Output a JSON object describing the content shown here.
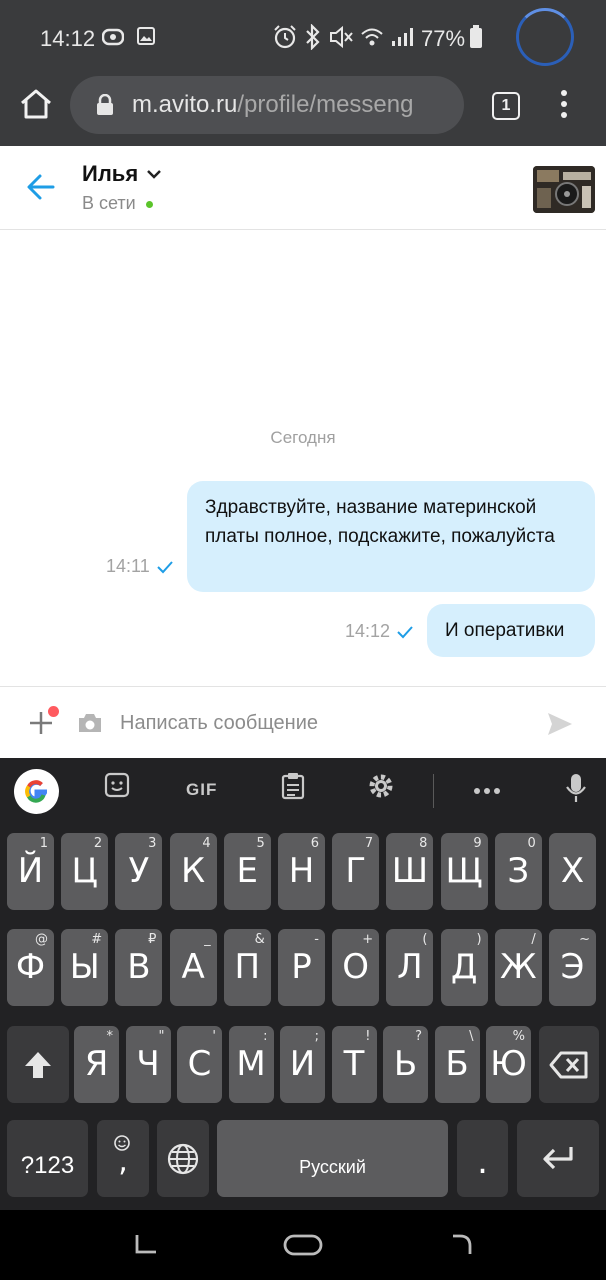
{
  "status_bar": {
    "time": "14:12",
    "battery": "77%"
  },
  "browser": {
    "url_host": "m.avito.ru",
    "url_path": "/profile/messeng",
    "tab_count": "1"
  },
  "chat": {
    "contact_name": "Илья",
    "status": "В сети",
    "day_label": "Сегодня",
    "messages": [
      {
        "text": "Здравствуйте, название материнской платы полное, подскажите, пожалуйста",
        "time": "14:11"
      },
      {
        "text": "И оперативки",
        "time": "14:12"
      }
    ]
  },
  "composer": {
    "placeholder": "Написать сообщение"
  },
  "keyboard": {
    "toolbar": {
      "gif_label": "GIF"
    },
    "row1": [
      {
        "label": "Й",
        "hint": "1"
      },
      {
        "label": "Ц",
        "hint": "2"
      },
      {
        "label": "У",
        "hint": "3"
      },
      {
        "label": "К",
        "hint": "4"
      },
      {
        "label": "Е",
        "hint": "5"
      },
      {
        "label": "Н",
        "hint": "6"
      },
      {
        "label": "Г",
        "hint": "7"
      },
      {
        "label": "Ш",
        "hint": "8"
      },
      {
        "label": "Щ",
        "hint": "9"
      },
      {
        "label": "З",
        "hint": "0"
      },
      {
        "label": "Х",
        "hint": ""
      }
    ],
    "row2": [
      {
        "label": "Ф",
        "hint": "@"
      },
      {
        "label": "Ы",
        "hint": "#"
      },
      {
        "label": "В",
        "hint": "₽"
      },
      {
        "label": "А",
        "hint": "_"
      },
      {
        "label": "П",
        "hint": "&"
      },
      {
        "label": "Р",
        "hint": "-"
      },
      {
        "label": "О",
        "hint": "+"
      },
      {
        "label": "Л",
        "hint": "("
      },
      {
        "label": "Д",
        "hint": ")"
      },
      {
        "label": "Ж",
        "hint": "/"
      },
      {
        "label": "Э",
        "hint": "~"
      }
    ],
    "row3": [
      {
        "label": "Я",
        "hint": "*"
      },
      {
        "label": "Ч",
        "hint": "\""
      },
      {
        "label": "С",
        "hint": "'"
      },
      {
        "label": "М",
        "hint": ":"
      },
      {
        "label": "И",
        "hint": ";"
      },
      {
        "label": "Т",
        "hint": "!"
      },
      {
        "label": "Ь",
        "hint": "?"
      },
      {
        "label": "Б",
        "hint": "\\"
      },
      {
        "label": "Ю",
        "hint": "%"
      }
    ],
    "bottom": {
      "symbols_label": "?123",
      "comma_label": ",",
      "space_label": "Русский",
      "period_label": "."
    }
  }
}
